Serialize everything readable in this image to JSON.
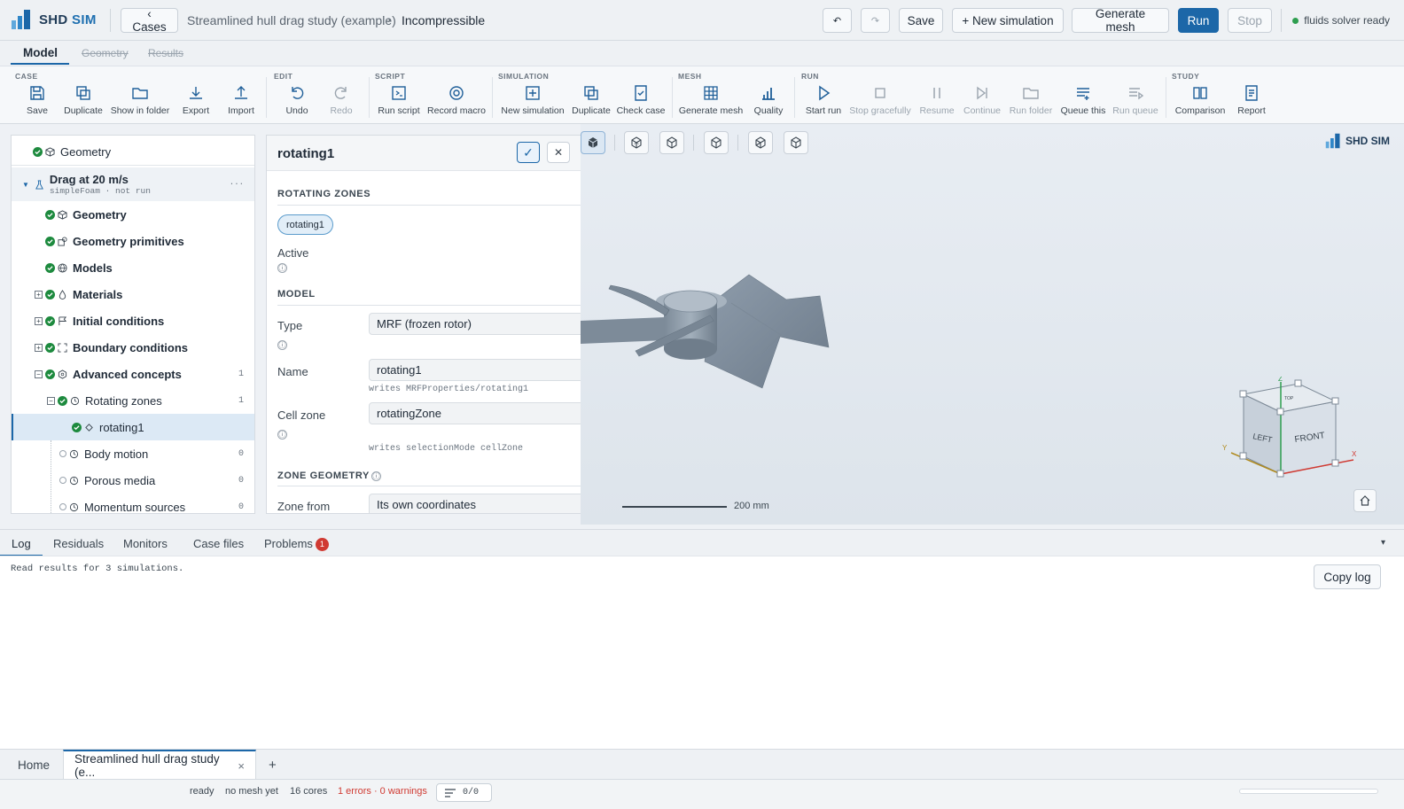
{
  "app": {
    "name_a": "SHD",
    "name_b": "SIM"
  },
  "header": {
    "cases_label": "‹ Cases",
    "project": "Streamlined hull drag study (example)",
    "separator": "›",
    "case": "Incompressible",
    "undo_glyph": "↶",
    "redo_glyph": "↷",
    "save": "Save",
    "new_sim": "+ New simulation",
    "gen_mesh": "Generate mesh",
    "run": "Run",
    "stop": "Stop",
    "status": "fluids solver ready",
    "status_color": "#2e9e4f"
  },
  "modetabs": {
    "model": "Model",
    "geometry": "Geometry",
    "results": "Results"
  },
  "ribbon": {
    "groups": [
      "CASE",
      "EDIT",
      "SCRIPT",
      "SIMULATION",
      "MESH",
      "RUN",
      "STUDY"
    ],
    "items": [
      "Save",
      "Duplicate",
      "Show in folder",
      "Export",
      "Import",
      "Undo",
      "Redo",
      "Run script",
      "Record macro",
      "New simulation",
      "Duplicate",
      "Check case",
      "Generate mesh",
      "Quality",
      "Start run",
      "Stop gracefully",
      "Resume",
      "Continue",
      "Run folder",
      "Queue this",
      "Run queue",
      "Comparison",
      "Report"
    ]
  },
  "tree": {
    "geometry_top": "Geometry",
    "sim_name": "Drag at 20 m/s",
    "sim_sub": "simpleFoam · not run",
    "more": "···",
    "items": [
      {
        "label": "Geometry",
        "count": ""
      },
      {
        "label": "Geometry primitives",
        "count": ""
      },
      {
        "label": "Models",
        "count": ""
      },
      {
        "label": "Materials",
        "count": ""
      },
      {
        "label": "Initial conditions",
        "count": ""
      },
      {
        "label": "Boundary conditions",
        "count": ""
      },
      {
        "label": "Advanced concepts",
        "count": "1"
      },
      {
        "label": "Rotating zones",
        "count": "1"
      },
      {
        "label": "rotating1",
        "count": ""
      },
      {
        "label": "Body motion",
        "count": "0"
      },
      {
        "label": "Porous media",
        "count": "0"
      },
      {
        "label": "Momentum sources",
        "count": "0"
      }
    ]
  },
  "panel": {
    "title": "rotating1",
    "ok": "✓",
    "close": "✕",
    "sec_zones": "ROTATING ZONES",
    "chip": "rotating1",
    "active_label": "Active",
    "info_glyph": "ⓘ",
    "sec_model": "MODEL",
    "type_label": "Type",
    "type_value": "MRF (frozen rotor)",
    "name_label": "Name",
    "name_value": "rotating1",
    "name_hint": "writes  MRFProperties/rotating1",
    "cell_label": "Cell zone",
    "cell_value": "rotatingZone",
    "cell_hint": "writes  selectionMode cellZone",
    "sec_geom": "ZONE GEOMETRY",
    "zone_label": "Zone from",
    "zone_value": "Its own coordinates"
  },
  "viewport": {
    "scale_label": "200 mm",
    "cube": {
      "left": "LEFT",
      "front": "FRONT",
      "top": "TOP",
      "x": "X",
      "y": "Y",
      "z": "Z"
    },
    "logo_a": "SHD",
    "logo_b": "SIM"
  },
  "bottom": {
    "tabs": [
      "Log",
      "Residuals",
      "Monitors",
      "Case files",
      "Problems"
    ],
    "problems_count": "1",
    "collapse": "▾",
    "log_line": "Read results for 3 simulations.",
    "copy_log": "Copy log"
  },
  "doctabs": {
    "home": "Home",
    "active": "Streamlined hull drag study (e...",
    "close": "×",
    "add": "+"
  },
  "statusbar": {
    "ready": "ready",
    "mesh": "no mesh yet",
    "cores": "16 cores",
    "errors": "1 errors · 0 warnings",
    "queue": "0/0"
  }
}
